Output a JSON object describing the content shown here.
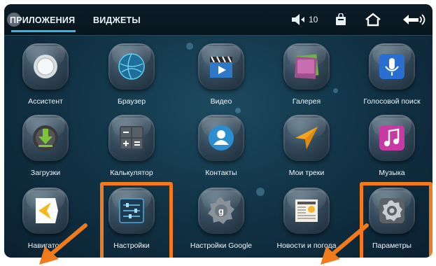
{
  "tabs": {
    "apps": "ПРИЛОЖЕНИЯ",
    "widgets": "ВИДЖЕТЫ"
  },
  "status": {
    "volume": "10",
    "volume_icon": "speaker-icon",
    "bag_icon": "shopping-bag-icon",
    "home_icon": "home-icon",
    "back_icon": "back-icon"
  },
  "apps": [
    {
      "label": "Ассистент",
      "icon": "assistant-icon"
    },
    {
      "label": "Браузер",
      "icon": "globe-icon"
    },
    {
      "label": "Видео",
      "icon": "video-clapper-icon"
    },
    {
      "label": "Галерея",
      "icon": "gallery-icon"
    },
    {
      "label": "Голосовой поиск",
      "icon": "microphone-icon"
    },
    {
      "label": "Загрузки",
      "icon": "download-icon"
    },
    {
      "label": "Калькулятор",
      "icon": "calculator-icon"
    },
    {
      "label": "Контакты",
      "icon": "contact-icon"
    },
    {
      "label": "Мои треки",
      "icon": "navigation-arrow-icon"
    },
    {
      "label": "Музыка",
      "icon": "music-note-icon"
    },
    {
      "label": "Навигатор",
      "icon": "navigator-icon"
    },
    {
      "label": "Настройки",
      "icon": "settings-sliders-icon"
    },
    {
      "label": "Настройки Google",
      "icon": "google-settings-icon"
    },
    {
      "label": "Новости и погода",
      "icon": "news-weather-icon"
    },
    {
      "label": "Параметры",
      "icon": "gear-icon"
    }
  ],
  "accent_color": "#33b5e5",
  "highlight_color": "#f07a1c"
}
